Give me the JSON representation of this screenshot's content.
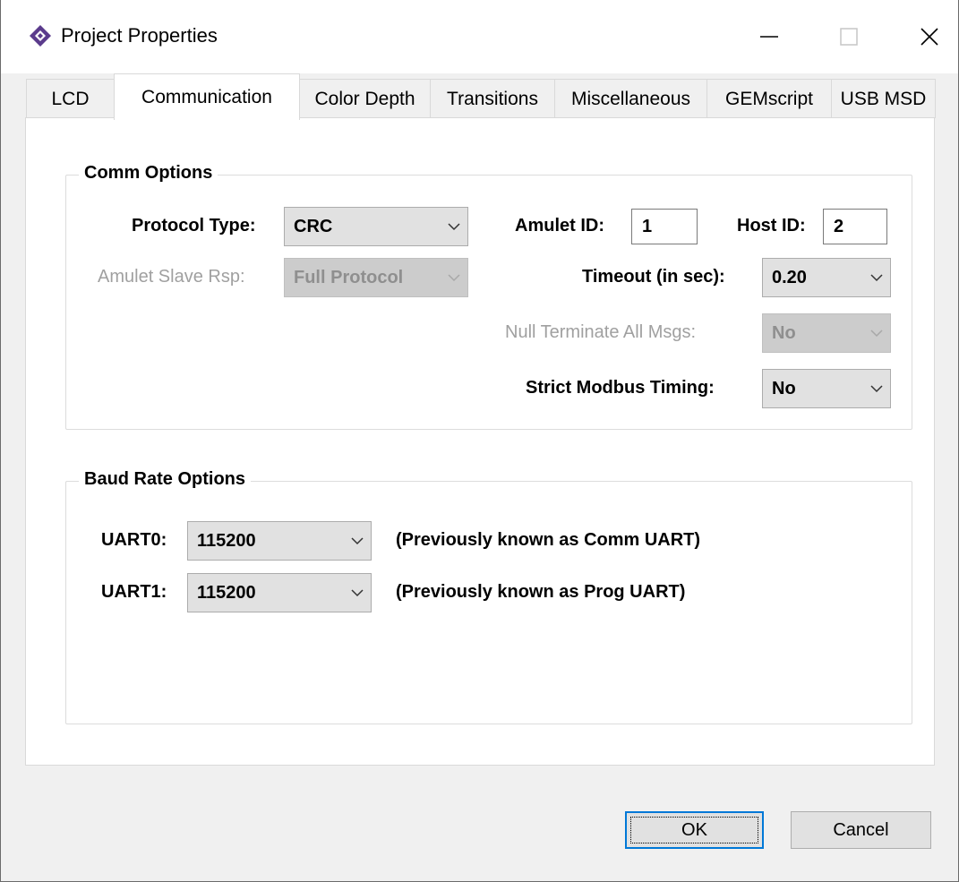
{
  "window": {
    "title": "Project Properties"
  },
  "tabs": [
    {
      "label": "LCD"
    },
    {
      "label": "Communication"
    },
    {
      "label": "Color Depth"
    },
    {
      "label": "Transitions"
    },
    {
      "label": "Miscellaneous"
    },
    {
      "label": "GEMscript"
    },
    {
      "label": "USB MSD"
    }
  ],
  "active_tab": "Communication",
  "comm_options": {
    "legend": "Comm Options",
    "protocol_type": {
      "label": "Protocol Type:",
      "value": "CRC"
    },
    "amulet_slave_rsp": {
      "label": "Amulet Slave Rsp:",
      "value": "Full Protocol",
      "enabled": false
    },
    "amulet_id": {
      "label": "Amulet ID:",
      "value": "1"
    },
    "host_id": {
      "label": "Host ID:",
      "value": "2"
    },
    "timeout": {
      "label": "Timeout (in sec):",
      "value": "0.20"
    },
    "null_terminate": {
      "label": "Null Terminate All Msgs:",
      "value": "No",
      "enabled": false
    },
    "strict_modbus": {
      "label": "Strict Modbus Timing:",
      "value": "No"
    }
  },
  "baud_options": {
    "legend": "Baud Rate Options",
    "uart0": {
      "label": "UART0:",
      "value": "115200",
      "note": "(Previously known as Comm UART)"
    },
    "uart1": {
      "label": "UART1:",
      "value": "115200",
      "note": "(Previously known as Prog UART)"
    }
  },
  "buttons": {
    "ok": "OK",
    "cancel": "Cancel"
  },
  "icons": {
    "app": "amulet-diamond-icon",
    "minimize": "minimize-icon",
    "maximize": "maximize-icon",
    "close": "close-icon",
    "dropdown": "chevron-down-icon"
  },
  "colors": {
    "accent": "#0078d7",
    "icon_purple": "#5b3b8c"
  }
}
